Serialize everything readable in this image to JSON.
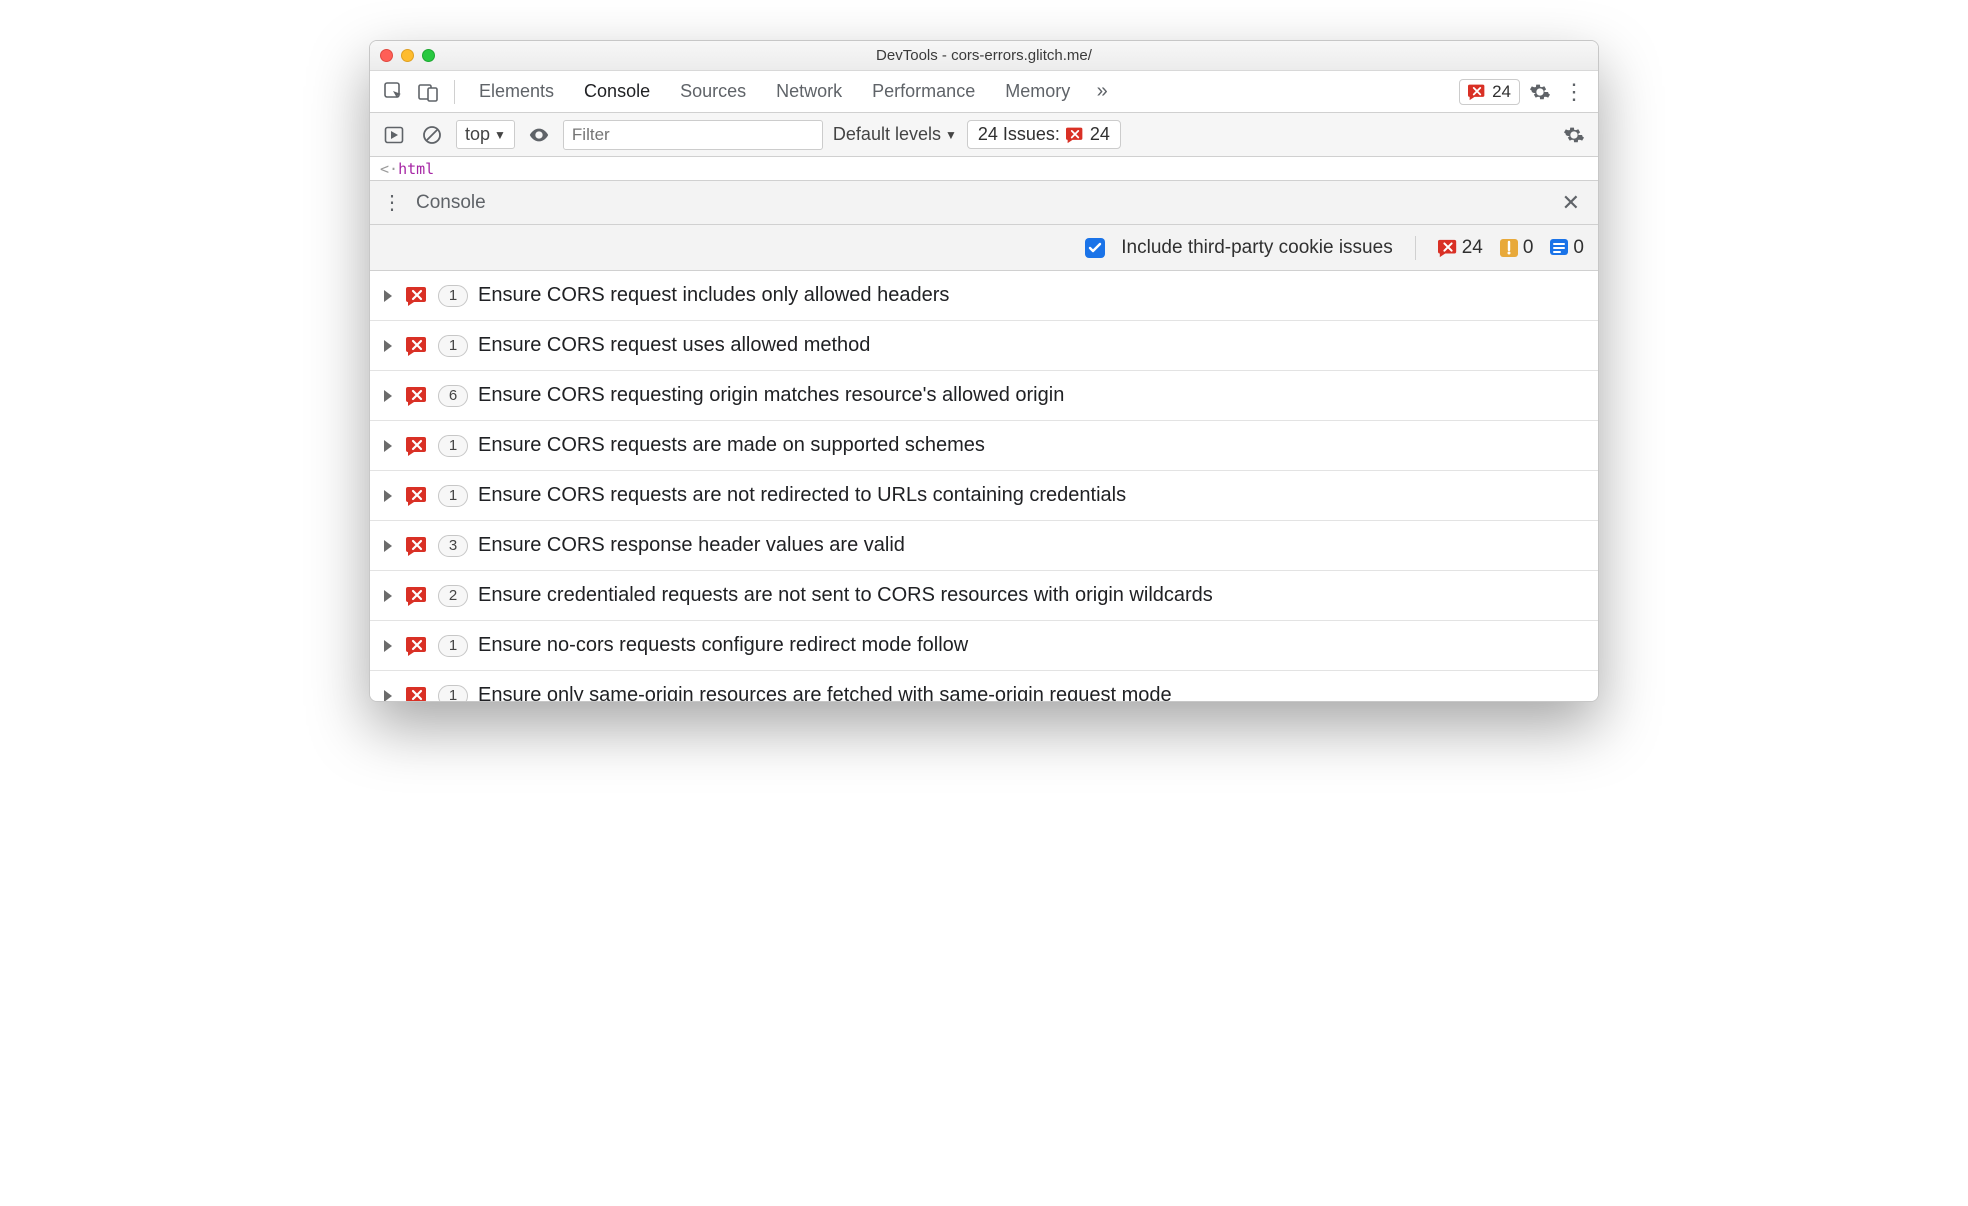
{
  "window": {
    "title": "DevTools - cors-errors.glitch.me/"
  },
  "tabs": {
    "items": [
      "Elements",
      "Console",
      "Sources",
      "Network",
      "Performance",
      "Memory"
    ],
    "active_index": 1,
    "error_badge_count": "24"
  },
  "filterbar": {
    "context": "top",
    "filter_placeholder": "Filter",
    "levels_label": "Default levels",
    "issues_label": "24 Issues:",
    "issues_count": "24"
  },
  "source_strip": {
    "prefix": "<·",
    "tag": "html"
  },
  "drawer": {
    "label": "Console"
  },
  "options": {
    "include_third_party_label": "Include third-party cookie issues",
    "include_third_party_checked": true,
    "errors": "24",
    "warnings": "0",
    "info": "0"
  },
  "issues": [
    {
      "count": "1",
      "text": "Ensure CORS request includes only allowed headers"
    },
    {
      "count": "1",
      "text": "Ensure CORS request uses allowed method"
    },
    {
      "count": "6",
      "text": "Ensure CORS requesting origin matches resource's allowed origin"
    },
    {
      "count": "1",
      "text": "Ensure CORS requests are made on supported schemes"
    },
    {
      "count": "1",
      "text": "Ensure CORS requests are not redirected to URLs containing credentials"
    },
    {
      "count": "3",
      "text": "Ensure CORS response header values are valid"
    },
    {
      "count": "2",
      "text": "Ensure credentialed requests are not sent to CORS resources with origin wildcards"
    },
    {
      "count": "1",
      "text": "Ensure no-cors requests configure redirect mode follow"
    },
    {
      "count": "1",
      "text": "Ensure only same-origin resources are fetched with same-origin request mode"
    }
  ]
}
